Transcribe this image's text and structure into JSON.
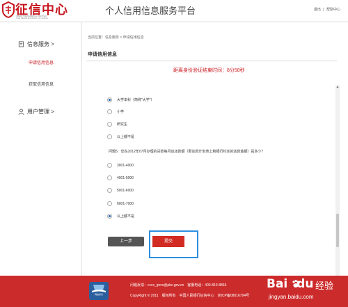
{
  "header": {
    "logo_text": "征信中心",
    "logo_en_line1": "CREDIT REFERENCE CENTER",
    "logo_en_line2": "THE PEOPLE'S BANK OF CHINA",
    "platform_title": "个人信用信息服务平台",
    "logout": "退出",
    "separator": "|",
    "help": "帮助中心"
  },
  "sidebar": {
    "info_service": {
      "label": "信息服务 >",
      "items": [
        "申请信用信息",
        "获取信用信息"
      ]
    },
    "user_manage": {
      "label": "用户管理 >"
    }
  },
  "main": {
    "breadcrumb": "当前位置：信息服务 > 申请信用信息",
    "section_title": "申请信用信息",
    "timer": "距离身份验证结束时间：8分58秒",
    "q1_options": [
      {
        "label": "大学本科（简称\"大学\"）",
        "checked": true
      },
      {
        "label": "小学",
        "checked": false
      },
      {
        "label": "研究生",
        "checked": false
      },
      {
        "label": "以上都不是",
        "checked": false
      }
    ],
    "q2_text": "问题5：您在2012年07月办理的贷款每月应还款额（即还款计划表上和银行约定的还款金额）是多少？",
    "q2_options": [
      {
        "label": "3001-4000",
        "checked": false
      },
      {
        "label": "4001-5000",
        "checked": false
      },
      {
        "label": "5001-6000",
        "checked": false
      },
      {
        "label": "6001-7000",
        "checked": false
      },
      {
        "label": "以上都不是",
        "checked": true
      }
    ],
    "prev_button": "上一步",
    "submit_button": "提交"
  },
  "footer": {
    "line1": "问题反馈：cccc_ipcrs@pbc.gov.cn　客服电话：400-810-8866",
    "line2": "CopyRight © 2011　版权所有　中国人民银行征信中心　京ICP备08016794号",
    "badge": "网站标识"
  },
  "watermark": {
    "brand": "Bai",
    "brand2": "du",
    "jingyan": "经验",
    "url": "jingyan.baidu.com"
  },
  "colors": {
    "brand_red": "#c8161d",
    "footer_red": "#cc2b2b",
    "nav_active": "#c8161d",
    "highlight_blue": "#2e8fe0"
  }
}
